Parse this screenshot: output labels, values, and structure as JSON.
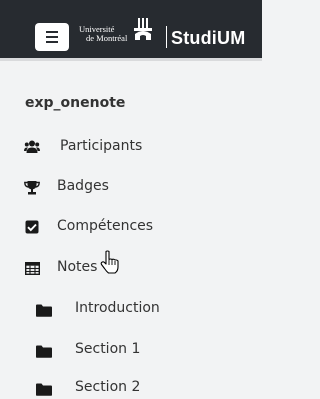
{
  "header": {
    "menu_icon": "hamburger-icon",
    "university_line1": "Université",
    "university_line2": "de Montréal",
    "brand": "StudiUM",
    "colors": {
      "header_bg": "#272b30",
      "logo": "#ffffff"
    }
  },
  "course": {
    "title": "exp_onenote"
  },
  "nav": [
    {
      "label": "Participants",
      "icon": "users-icon"
    },
    {
      "label": "Badges",
      "icon": "trophy-icon"
    },
    {
      "label": "Compétences",
      "icon": "checkbox-icon"
    },
    {
      "label": "Notes",
      "icon": "table-icon"
    },
    {
      "label": "Introduction",
      "icon": "folder-icon"
    },
    {
      "label": "Section 1",
      "icon": "folder-icon"
    },
    {
      "label": "Section 2",
      "icon": "folder-icon"
    }
  ],
  "cursor": "hand-pointer-cursor"
}
